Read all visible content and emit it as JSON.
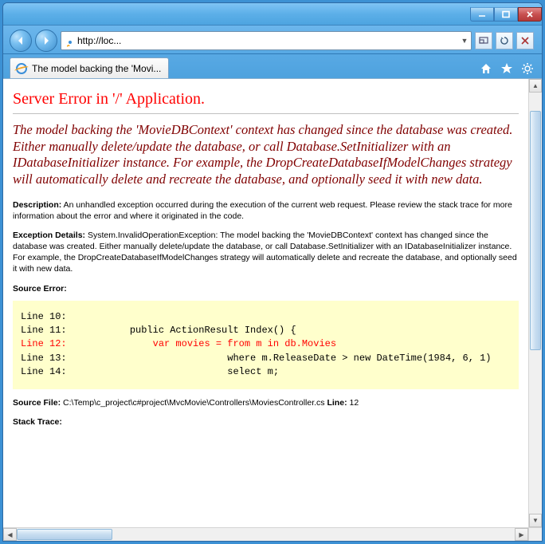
{
  "window": {
    "min": "—",
    "max": "▢",
    "close": "✕"
  },
  "address": {
    "url": "http://loc...",
    "dropdown": "▼"
  },
  "tab": {
    "title": "The model backing the 'Movi..."
  },
  "error": {
    "heading": "Server Error in '/' Application.",
    "message": "The model backing the 'MovieDBContext' context has changed since the database was created. Either manually delete/update the database, or call Database.SetInitializer with an IDatabaseInitializer instance. For example, the DropCreateDatabaseIfModelChanges strategy will automatically delete and recreate the database, and optionally seed it with new data.",
    "description_label": "Description:",
    "description_text": " An unhandled exception occurred during the execution of the current web request. Please review the stack trace for more information about the error and where it originated in the code.",
    "exception_label": "Exception Details:",
    "exception_text": " System.InvalidOperationException: The model backing the 'MovieDBContext' context has changed since the database was created. Either manually delete/update the database, or call Database.SetInitializer with an IDatabaseInitializer instance. For example, the DropCreateDatabaseIfModelChanges strategy will automatically delete and recreate the database, and optionally seed it with new data.",
    "source_error_label": "Source Error:",
    "source_file_label": "Source File:",
    "source_file_value": " C:\\Temp\\c_project\\c#project\\MvcMovie\\Controllers\\MoviesController.cs",
    "line_label": "    Line:",
    "line_value": " 12",
    "stack_trace_label": "Stack Trace:",
    "code": {
      "l10": "Line 10:",
      "l11": "Line 11:           public ActionResult Index() {",
      "l12": "Line 12:               var movies = from m in db.Movies",
      "l13": "Line 13:                            where m.ReleaseDate > new DateTime(1984, 6, 1)",
      "l14": "Line 14:                            select m;"
    }
  }
}
